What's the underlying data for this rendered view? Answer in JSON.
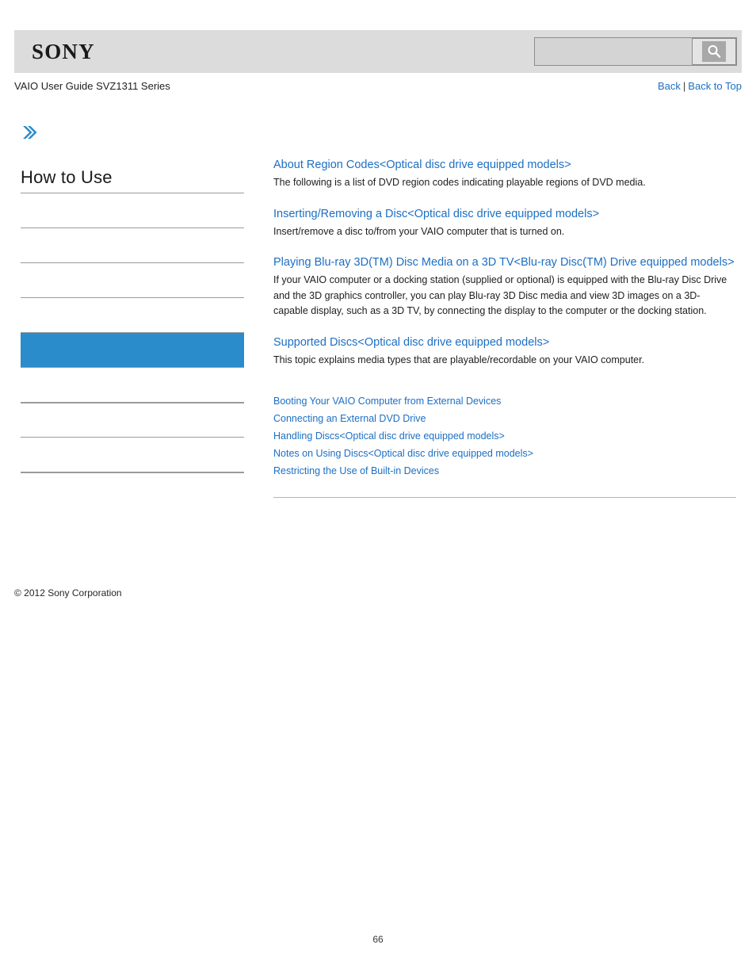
{
  "header": {
    "logo_text": "SONY",
    "search": {
      "value": "",
      "placeholder": "",
      "button_icon": "search-icon"
    }
  },
  "subheader": {
    "guide_title": "VAIO User Guide SVZ1311 Series",
    "back_label": "Back",
    "separator": "|",
    "back_to_top_label": "Back to Top"
  },
  "sidebar": {
    "chevron_icon": "double-chevron-right-icon",
    "heading": "How to Use",
    "accent_color": "#2b8ccb",
    "items": [
      {
        "label": "",
        "active": false
      },
      {
        "label": "",
        "active": false
      },
      {
        "label": "",
        "active": false
      },
      {
        "label": "",
        "active": false
      },
      {
        "label": "",
        "active": true
      },
      {
        "label": "",
        "active": false
      },
      {
        "label": "",
        "active": false
      },
      {
        "label": "",
        "active": false
      },
      {
        "label": "",
        "active": false
      }
    ]
  },
  "content": {
    "topics": [
      {
        "title": "About Region Codes<Optical disc drive equipped models>",
        "description": "The following is a list of DVD region codes indicating playable regions of DVD media."
      },
      {
        "title": "Inserting/Removing a Disc<Optical disc drive equipped models>",
        "description": "Insert/remove a disc to/from your VAIO computer that is turned on."
      },
      {
        "title": "Playing Blu-ray 3D(TM) Disc Media on a 3D TV<Blu-ray Disc(TM) Drive equipped models>",
        "description": "If your VAIO computer or a docking station (supplied or optional) is equipped with the Blu-ray Disc Drive and the 3D graphics controller, you can play Blu-ray 3D Disc media and view 3D images on a 3D-capable display, such as a 3D TV, by connecting the display to the computer or the docking station."
      },
      {
        "title": "Supported Discs<Optical disc drive equipped models>",
        "description": "This topic explains media types that are playable/recordable on your VAIO computer."
      }
    ],
    "related_links": [
      "Booting Your VAIO Computer from External Devices",
      "Connecting an External DVD Drive",
      "Handling Discs<Optical disc drive equipped models>",
      "Notes on Using Discs<Optical disc drive equipped models>",
      "Restricting the Use of Built-in Devices"
    ]
  },
  "footer": {
    "copyright": "© 2012 Sony Corporation",
    "page_number": "66"
  }
}
